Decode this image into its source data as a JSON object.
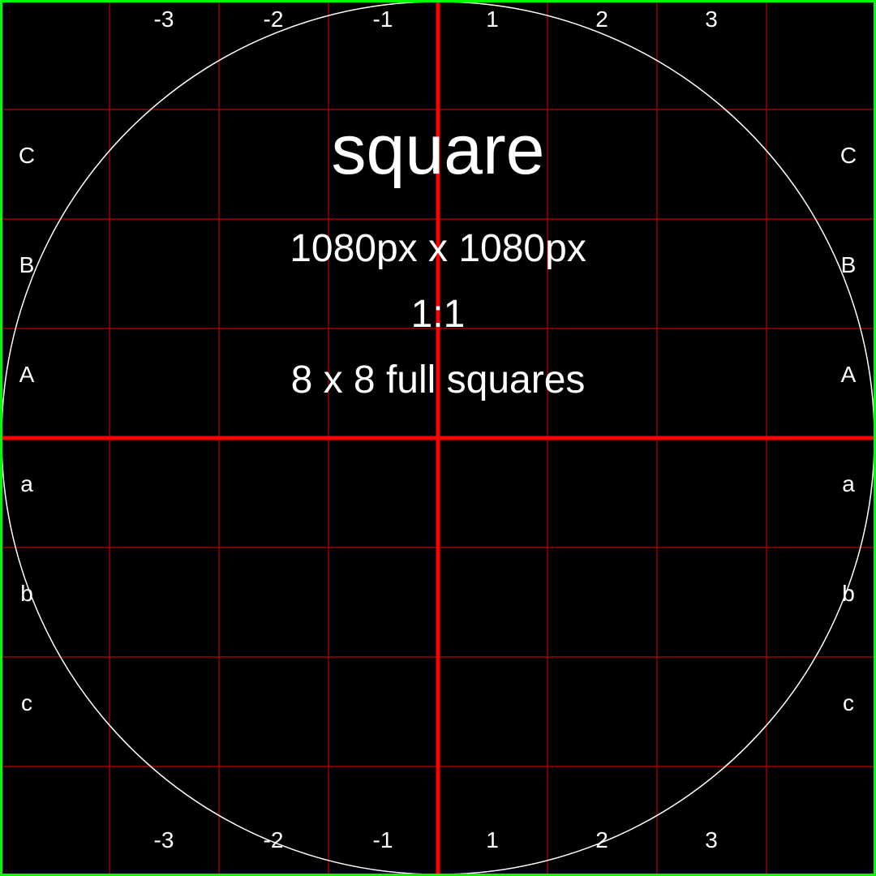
{
  "title": "square",
  "dimensions": "1080px x 1080px",
  "ratio": "1:1",
  "squares": "8 x 8 full squares",
  "column_labels": [
    "-3",
    "-2",
    "-1",
    "1",
    "2",
    "3"
  ],
  "row_labels": [
    "C",
    "B",
    "A",
    "a",
    "b",
    "c"
  ],
  "colors": {
    "background": "#000000",
    "grid": "#c00000",
    "axis": "#ff0000",
    "border": "#00ff00",
    "circle": "#ffffff",
    "text": "#ffffff"
  }
}
